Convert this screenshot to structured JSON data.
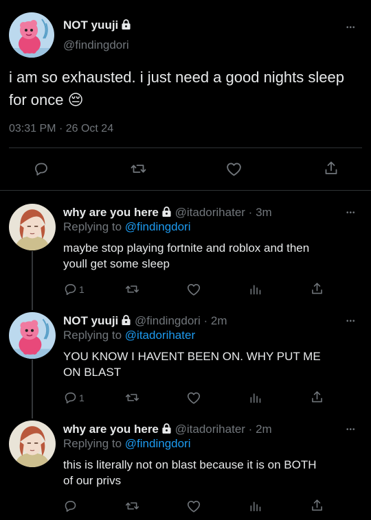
{
  "main_tweet": {
    "display_name": "NOT yuuji",
    "handle": "@findingdori",
    "text": "i am so exhausted. i just need a good nights sleep for once",
    "emoji": "😔",
    "time": "03:31 PM",
    "sep": "·",
    "date": "26 Oct 24"
  },
  "replies": [
    {
      "display_name": "why are you here",
      "handle": "@itadorihater",
      "sep": "·",
      "age": "3m",
      "replying_prefix": "Replying to",
      "replying_to": "@findingdori",
      "text_line1": "maybe stop playing fortnite and roblox and then",
      "text_line2": "youll get some sleep",
      "reply_count": "1"
    },
    {
      "display_name": "NOT yuuji",
      "handle": "@findingdori",
      "sep": "·",
      "age": "2m",
      "replying_prefix": "Replying to",
      "replying_to": "@itadorihater",
      "text_line1": "YOU KNOW I HAVENT BEEN ON. WHY PUT ME",
      "text_line2": "ON BLAST",
      "reply_count": "1"
    },
    {
      "display_name": "why are you here",
      "handle": "@itadorihater",
      "sep": "·",
      "age": "2m",
      "replying_prefix": "Replying to",
      "replying_to": "@findingdori",
      "text_line1": "this is literally not on blast because it is on BOTH",
      "text_line2": "of our privs",
      "reply_count": ""
    }
  ],
  "more_glyph": "•••",
  "icons": [
    "reply-icon",
    "retweet-icon",
    "like-icon",
    "share-icon",
    "analytics-icon",
    "lock-icon",
    "more-icon"
  ],
  "colors": {
    "background": "#000000",
    "text": "#e7e9ea",
    "muted": "#71767b",
    "link": "#1d9bf0",
    "divider": "#2f3336"
  }
}
